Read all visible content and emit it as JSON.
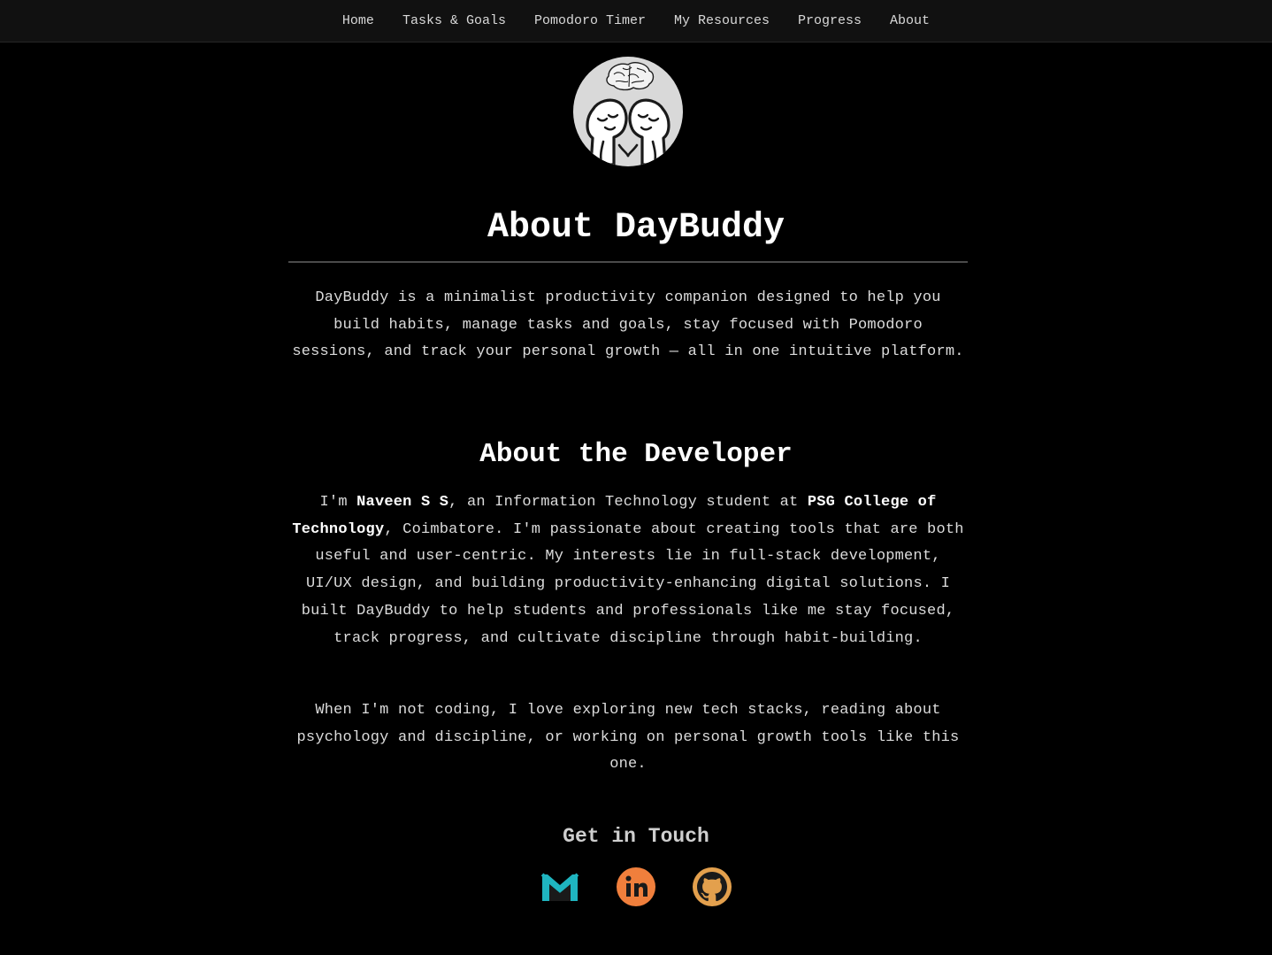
{
  "nav": {
    "items": [
      {
        "label": "Home"
      },
      {
        "label": "Tasks & Goals"
      },
      {
        "label": "Pomodoro Timer"
      },
      {
        "label": "My Resources"
      },
      {
        "label": "Progress"
      },
      {
        "label": "About"
      }
    ]
  },
  "page": {
    "title": "About DayBuddy",
    "intro": "DayBuddy is a minimalist productivity companion designed to help you build habits, manage tasks and goals, stay focused with Pomodoro sessions, and track your personal growth — all in one intuitive platform."
  },
  "developer": {
    "heading": "About the Developer",
    "p1_a": "I'm ",
    "name": "Naveen S S",
    "p1_b": ", an Information Technology student at ",
    "college": "PSG College of Technology",
    "p1_c": ", Coimbatore. I'm passionate about creating tools that are both useful and user-centric. My interests lie in full-stack development, UI/UX design, and building productivity-enhancing digital solutions. I built DayBuddy to help students and professionals like me stay focused, track progress, and cultivate discipline through habit-building.",
    "p2": "When I'm not coding, I love exploring new tech stacks, reading about psychology and discipline, or working on personal growth tools like this one."
  },
  "contact": {
    "heading": "Get in Touch",
    "icons": [
      "gmail-icon",
      "linkedin-icon",
      "github-icon"
    ]
  },
  "colors": {
    "background": "#000000",
    "nav_bg": "#111111",
    "text": "#dcdcdc",
    "heading": "#ffffff",
    "gmail_accent": "#1fb5c0",
    "linkedin": "#f07f3c",
    "github": "#e3a04d"
  }
}
